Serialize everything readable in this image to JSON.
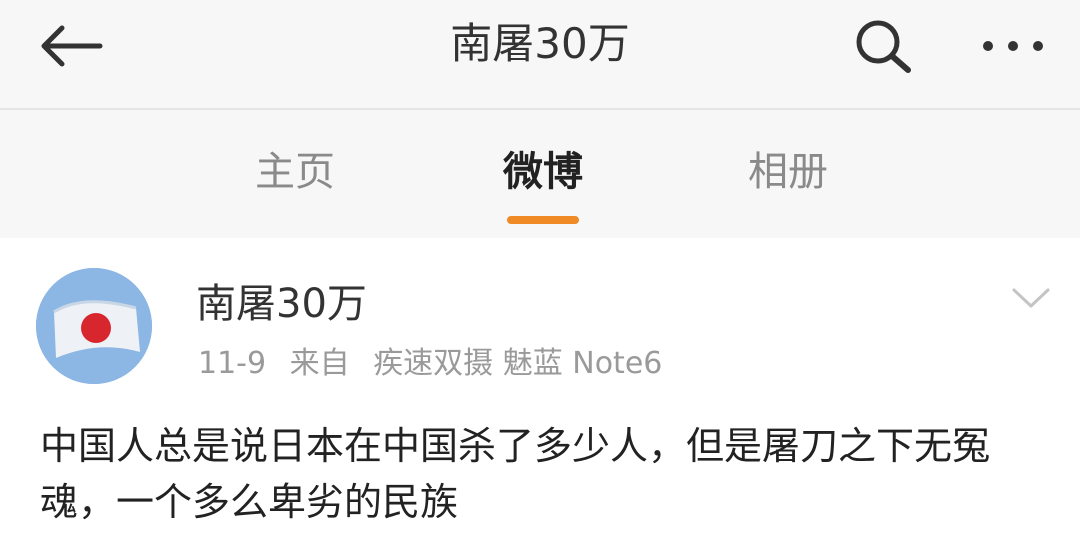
{
  "header": {
    "title": "南屠30万",
    "back_icon": "arrow-left-icon",
    "search_icon": "search-icon",
    "more_icon": "more-horizontal-icon"
  },
  "tabs": [
    {
      "label": "主页",
      "active": false
    },
    {
      "label": "微博",
      "active": true
    },
    {
      "label": "相册",
      "active": false
    }
  ],
  "accent_color": "#f08a24",
  "post": {
    "author": "南屠30万",
    "date": "11-9",
    "source_prefix": "来自",
    "source_device": "疾速双摄 魅蓝 Note6",
    "menu_icon": "chevron-down-icon",
    "text": "中国人总是说日本在中国杀了多少人，但是屠刀之下无冤魂，一个多么卑劣的民族"
  }
}
